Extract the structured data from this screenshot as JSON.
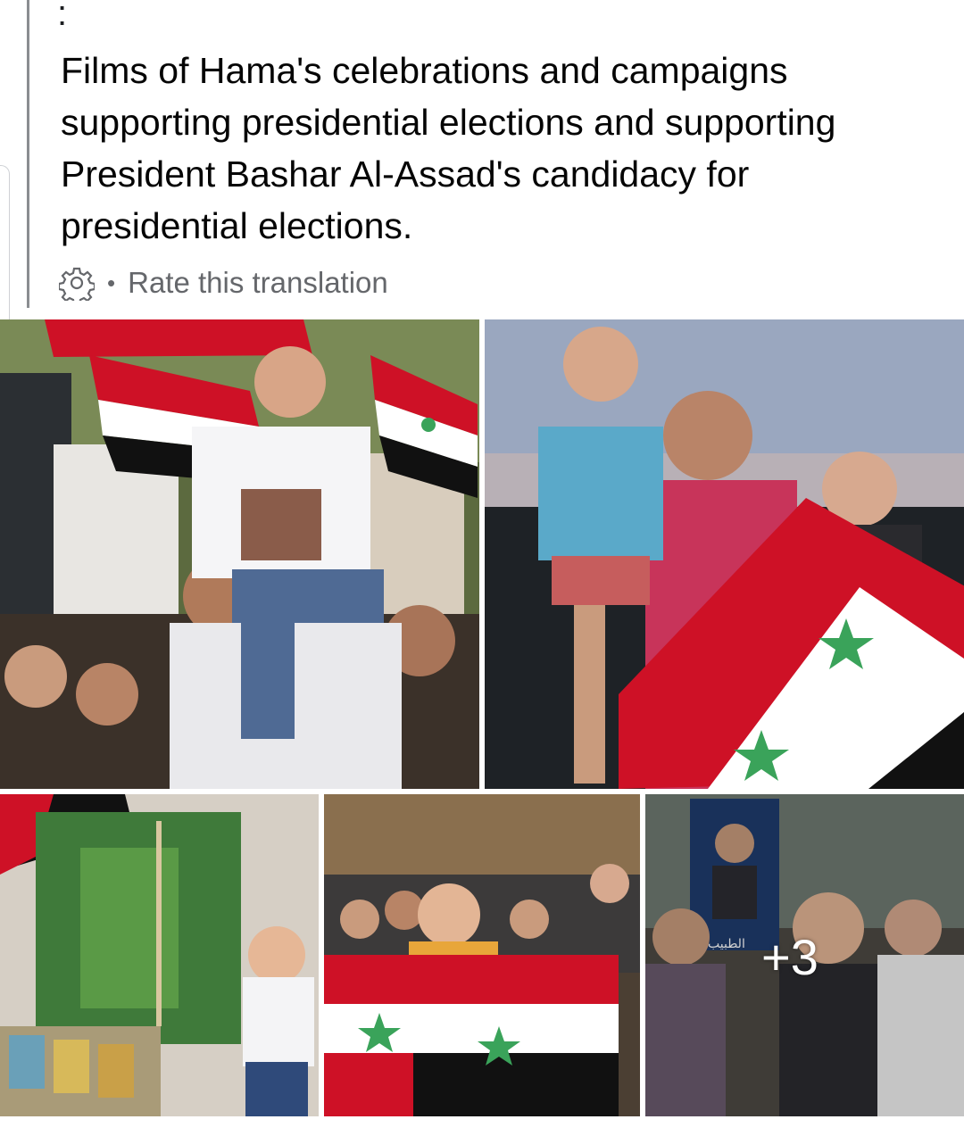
{
  "post": {
    "overflow_menu": ":",
    "text": "Films of Hama's celebrations and campaigns supporting presidential elections and supporting President Bashar Al-Assad's candidacy for presidential elections.",
    "translation": {
      "separator": "•",
      "label": "Rate this translation",
      "icon": "gear-icon"
    }
  },
  "photos": {
    "more_count": "+3",
    "poster_text": "الطبيب"
  },
  "colors": {
    "flag_red": "#ce1126",
    "flag_white": "#ffffff",
    "flag_black": "#111111",
    "flag_star": "#3aa35a",
    "secondary_text": "#65676b"
  }
}
